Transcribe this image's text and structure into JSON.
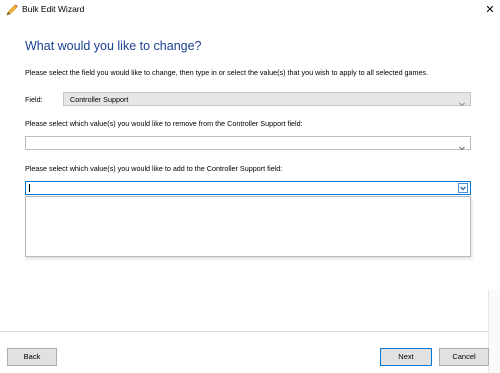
{
  "window": {
    "title": "Bulk Edit Wizard",
    "close_symbol": "✕",
    "icon": "pencil-icon"
  },
  "main": {
    "heading": "What would you like to change?",
    "instruction": "Please select the field you would like to change, then type in or select the value(s) that you wish to apply to all selected games.",
    "field_label": "Field:",
    "field_value": "Controller Support",
    "remove_label": "Please select which value(s) you would like to remove from the Controller Support field:",
    "remove_value": "",
    "add_label": "Please select which value(s) you would like to add to the Controller Support field:",
    "add_value": ""
  },
  "buttons": {
    "back": "Back",
    "next": "Next",
    "cancel": "Cancel"
  },
  "colors": {
    "heading": "#1b3f92",
    "focus_border": "#0078d7",
    "button_face": "#e1e1e1"
  }
}
